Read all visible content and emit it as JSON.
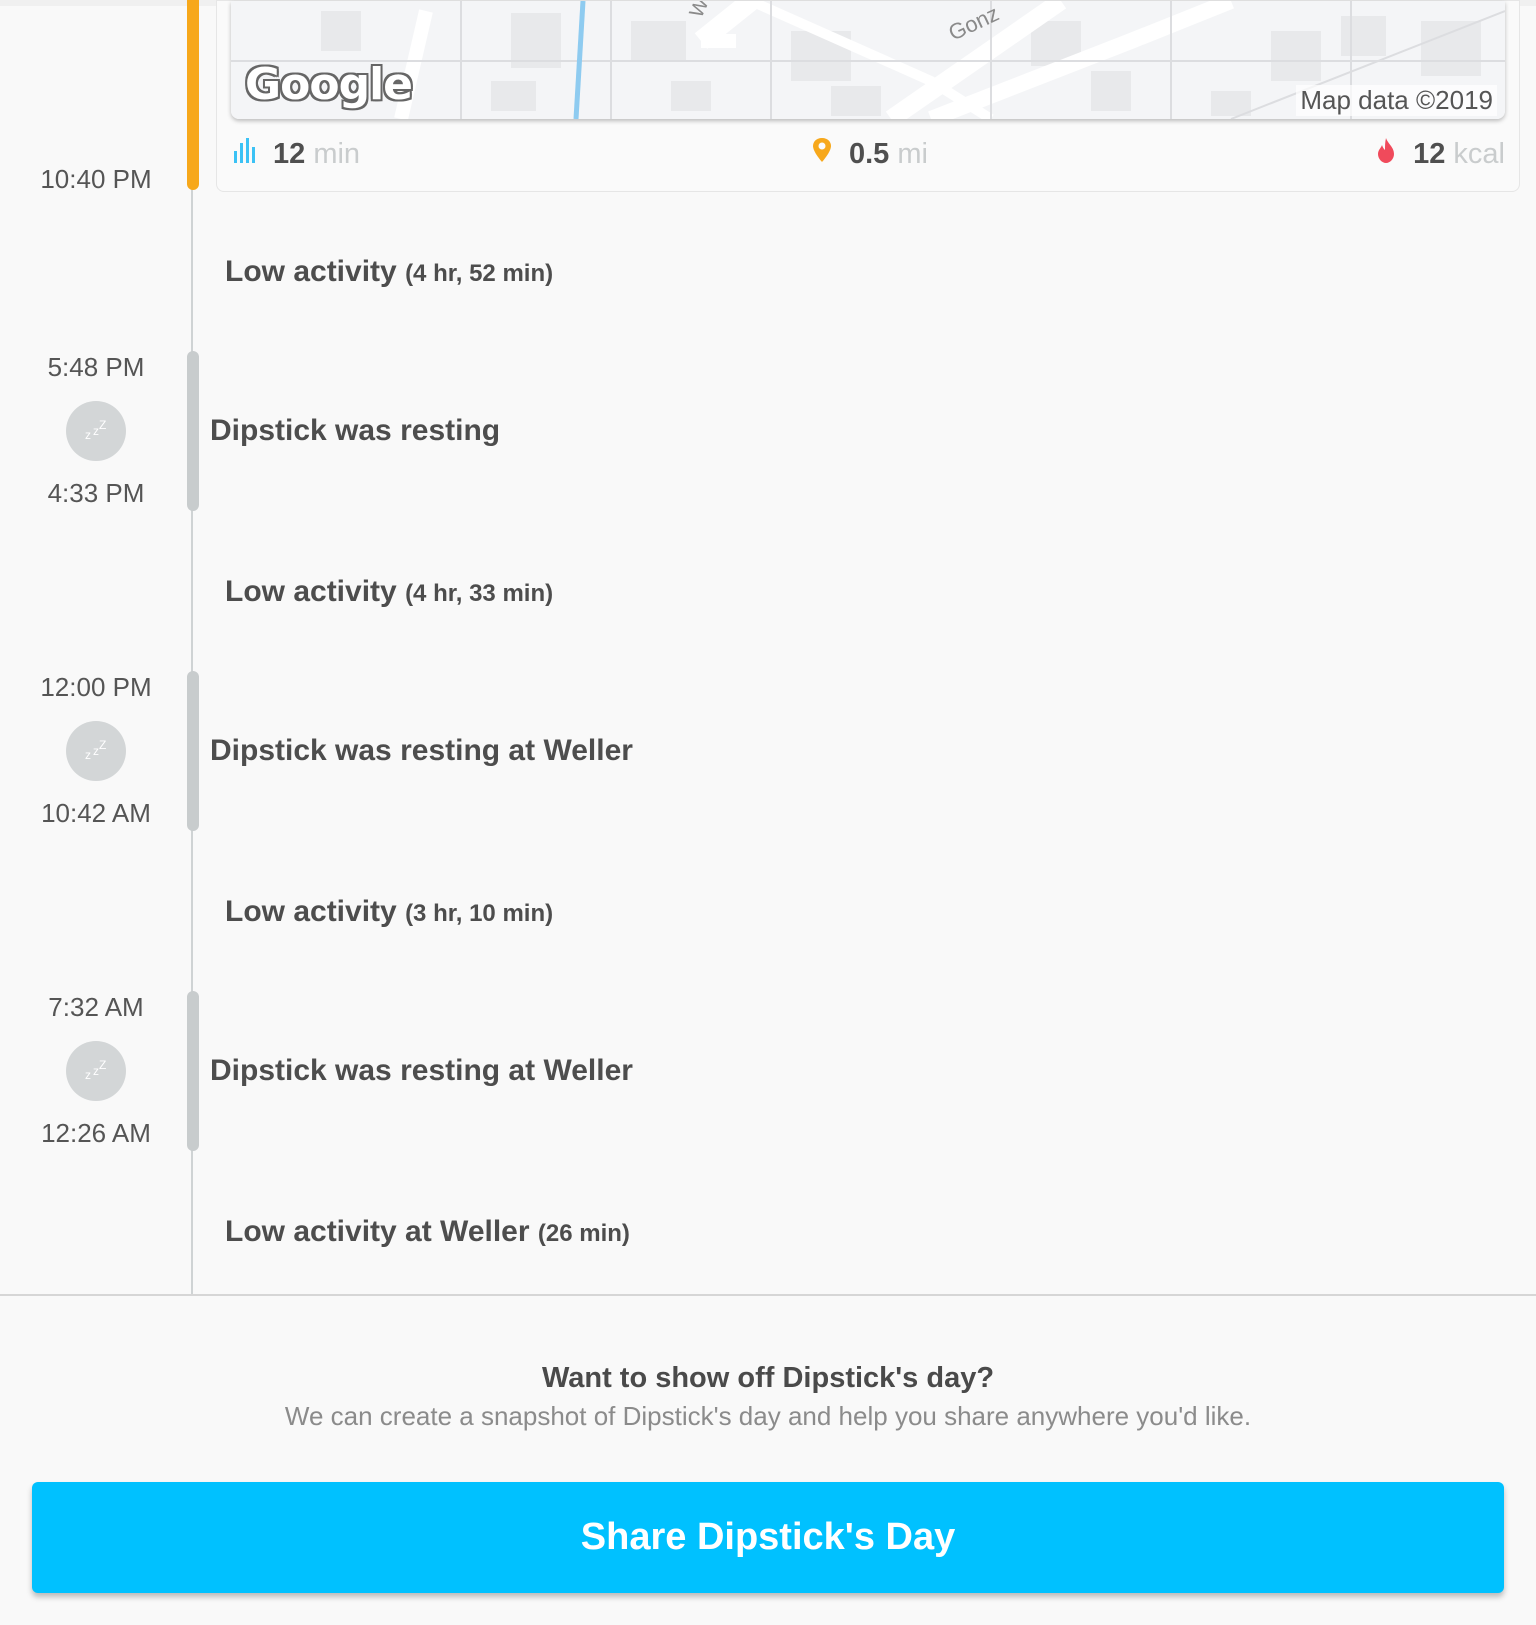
{
  "map": {
    "logo": "Google",
    "credit": "Map data ©2019",
    "street_1": "Gonz",
    "street_2": "W"
  },
  "stats": {
    "duration_value": "12",
    "duration_unit": "min",
    "distance_value": "0.5",
    "distance_unit": "mi",
    "calories_value": "12",
    "calories_unit": "kcal",
    "duration_icon": "activity-bars-icon",
    "distance_icon": "location-pin-icon",
    "calories_icon": "flame-icon"
  },
  "timeline": {
    "walk_end_time": "10:40 PM",
    "low_activity_1": {
      "label": "Low activity",
      "duration": "(4 hr, 52 min)"
    },
    "rest_1": {
      "start": "5:48 PM",
      "end": "4:33 PM",
      "label": "Dipstick was resting"
    },
    "low_activity_2": {
      "label": "Low activity",
      "duration": "(4 hr, 33 min)"
    },
    "rest_2": {
      "start": "12:00 PM",
      "end": "10:42 AM",
      "label": "Dipstick was resting at Weller"
    },
    "low_activity_3": {
      "label": "Low activity",
      "duration": "(3 hr, 10 min)"
    },
    "rest_3": {
      "start": "7:32 AM",
      "end": "12:26 AM",
      "label": "Dipstick was resting at Weller"
    },
    "low_activity_4": {
      "label": "Low activity at Weller",
      "duration": "(26 min)"
    }
  },
  "share": {
    "title": "Want to show off Dipstick's day?",
    "subtitle": "We can create a snapshot of Dipstick's day and help you share anywhere you'd like.",
    "button_label": "Share Dipstick's Day"
  },
  "colors": {
    "walk_accent": "#f7a81b",
    "button": "#00c1ff",
    "activity_icon": "#3bc2f5",
    "pin_icon": "#f7a81b",
    "flame_icon": "#f04a5b"
  }
}
